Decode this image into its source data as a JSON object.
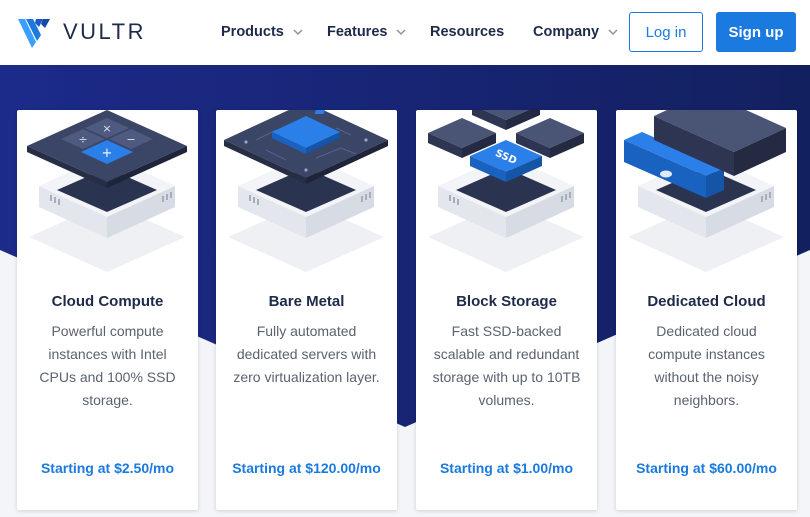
{
  "header": {
    "logo_text": "VULTR",
    "nav": [
      {
        "label": "Products",
        "has_dropdown": true
      },
      {
        "label": "Features",
        "has_dropdown": true
      },
      {
        "label": "Resources",
        "has_dropdown": false
      },
      {
        "label": "Company",
        "has_dropdown": true
      }
    ],
    "login_label": "Log in",
    "signup_label": "Sign up"
  },
  "colors": {
    "accent": "#1a7ae0",
    "navy": "#1e2a4a",
    "hero_blue": "#1b2a86"
  },
  "cards": [
    {
      "icon": "calculator-server-icon",
      "title": "Cloud Compute",
      "description": "Powerful compute instances with Intel CPUs and 100% SSD storage.",
      "price": "Starting at $2.50/mo"
    },
    {
      "icon": "cpu-chip-server-icon",
      "title": "Bare Metal",
      "description": "Fully automated dedicated servers with zero virtualization layer.",
      "price": "Starting at $120.00/mo"
    },
    {
      "icon": "ssd-storage-server-icon",
      "title": "Block Storage",
      "description": "Fast SSD-backed scalable and redundant storage with up to 10TB volumes.",
      "price": "Starting at $1.00/mo"
    },
    {
      "icon": "dedicated-cloud-server-icon",
      "title": "Dedicated Cloud",
      "description": "Dedicated cloud compute instances without the noisy neighbors.",
      "price": "Starting at $60.00/mo"
    }
  ],
  "illus": {
    "calc_plus": "+",
    "calc_times": "×",
    "calc_divide": "÷",
    "calc_minus": "−",
    "ssd_label": "SSD"
  }
}
